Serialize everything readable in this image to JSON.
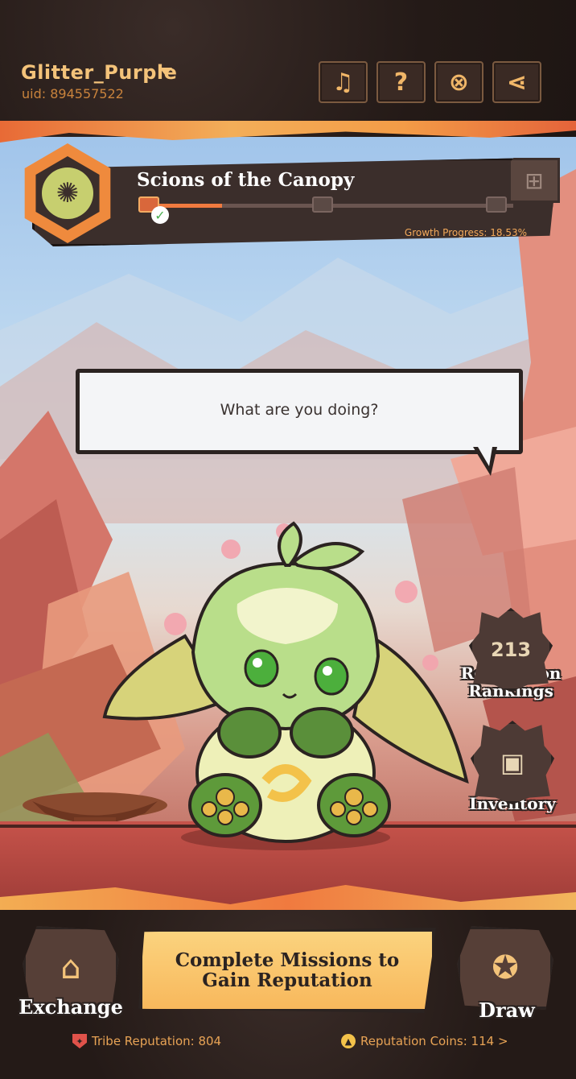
{
  "header": {
    "player_name": "Glitter_Purple",
    "uid": "uid: 894557522",
    "buttons": [
      {
        "name": "music-button",
        "icon": "music-note-icon",
        "glyph": "♫"
      },
      {
        "name": "help-button",
        "icon": "question-mark-icon",
        "glyph": "?"
      },
      {
        "name": "map-button",
        "icon": "map-icon",
        "glyph": "⊗"
      },
      {
        "name": "share-button",
        "icon": "share-icon",
        "glyph": "⋖"
      }
    ]
  },
  "tribe": {
    "name": "Scions of the Canopy",
    "growth_label": "Growth Progress: 18.53%",
    "growth_progress": 0.1853,
    "milestones_completed": 1,
    "milestones_total": 3,
    "emblem_icon": "tribe-emblem-icon",
    "gift_icon": "gift-box-icon"
  },
  "dialogue": {
    "text": "What are you doing?"
  },
  "side_buttons": {
    "rankings": {
      "line1": "Reputation",
      "line2": "Rankings",
      "icon": "podium-icon",
      "glyph": "213"
    },
    "inventory": {
      "label": "Inventory",
      "icon": "backpack-icon",
      "glyph": "▣"
    }
  },
  "bottom": {
    "exchange_label": "Exchange",
    "exchange_icon": "market-stall-icon",
    "mission_line1": "Complete Missions to",
    "mission_line2": "Gain Reputation",
    "draw_label": "Draw",
    "draw_icon": "gacha-icon",
    "tribe_reputation": "Tribe Reputation: 804",
    "reputation_coins": "Reputation Coins: 114 >"
  },
  "colors": {
    "accent_orange": "#f07a3f",
    "gold_text": "#f4c37a",
    "dark_brown": "#2b2321",
    "creature_green": "#9fcf6a"
  }
}
